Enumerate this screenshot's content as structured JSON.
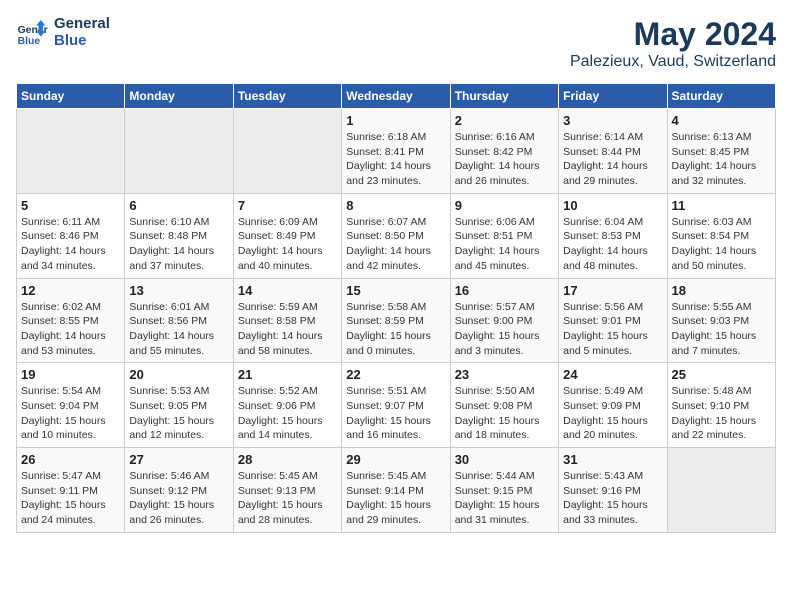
{
  "logo": {
    "line1": "General",
    "line2": "Blue"
  },
  "title": "May 2024",
  "location": "Palezieux, Vaud, Switzerland",
  "days_of_week": [
    "Sunday",
    "Monday",
    "Tuesday",
    "Wednesday",
    "Thursday",
    "Friday",
    "Saturday"
  ],
  "weeks": [
    [
      {
        "day": "",
        "content": ""
      },
      {
        "day": "",
        "content": ""
      },
      {
        "day": "",
        "content": ""
      },
      {
        "day": "1",
        "content": "Sunrise: 6:18 AM\nSunset: 8:41 PM\nDaylight: 14 hours\nand 23 minutes."
      },
      {
        "day": "2",
        "content": "Sunrise: 6:16 AM\nSunset: 8:42 PM\nDaylight: 14 hours\nand 26 minutes."
      },
      {
        "day": "3",
        "content": "Sunrise: 6:14 AM\nSunset: 8:44 PM\nDaylight: 14 hours\nand 29 minutes."
      },
      {
        "day": "4",
        "content": "Sunrise: 6:13 AM\nSunset: 8:45 PM\nDaylight: 14 hours\nand 32 minutes."
      }
    ],
    [
      {
        "day": "5",
        "content": "Sunrise: 6:11 AM\nSunset: 8:46 PM\nDaylight: 14 hours\nand 34 minutes."
      },
      {
        "day": "6",
        "content": "Sunrise: 6:10 AM\nSunset: 8:48 PM\nDaylight: 14 hours\nand 37 minutes."
      },
      {
        "day": "7",
        "content": "Sunrise: 6:09 AM\nSunset: 8:49 PM\nDaylight: 14 hours\nand 40 minutes."
      },
      {
        "day": "8",
        "content": "Sunrise: 6:07 AM\nSunset: 8:50 PM\nDaylight: 14 hours\nand 42 minutes."
      },
      {
        "day": "9",
        "content": "Sunrise: 6:06 AM\nSunset: 8:51 PM\nDaylight: 14 hours\nand 45 minutes."
      },
      {
        "day": "10",
        "content": "Sunrise: 6:04 AM\nSunset: 8:53 PM\nDaylight: 14 hours\nand 48 minutes."
      },
      {
        "day": "11",
        "content": "Sunrise: 6:03 AM\nSunset: 8:54 PM\nDaylight: 14 hours\nand 50 minutes."
      }
    ],
    [
      {
        "day": "12",
        "content": "Sunrise: 6:02 AM\nSunset: 8:55 PM\nDaylight: 14 hours\nand 53 minutes."
      },
      {
        "day": "13",
        "content": "Sunrise: 6:01 AM\nSunset: 8:56 PM\nDaylight: 14 hours\nand 55 minutes."
      },
      {
        "day": "14",
        "content": "Sunrise: 5:59 AM\nSunset: 8:58 PM\nDaylight: 14 hours\nand 58 minutes."
      },
      {
        "day": "15",
        "content": "Sunrise: 5:58 AM\nSunset: 8:59 PM\nDaylight: 15 hours\nand 0 minutes."
      },
      {
        "day": "16",
        "content": "Sunrise: 5:57 AM\nSunset: 9:00 PM\nDaylight: 15 hours\nand 3 minutes."
      },
      {
        "day": "17",
        "content": "Sunrise: 5:56 AM\nSunset: 9:01 PM\nDaylight: 15 hours\nand 5 minutes."
      },
      {
        "day": "18",
        "content": "Sunrise: 5:55 AM\nSunset: 9:03 PM\nDaylight: 15 hours\nand 7 minutes."
      }
    ],
    [
      {
        "day": "19",
        "content": "Sunrise: 5:54 AM\nSunset: 9:04 PM\nDaylight: 15 hours\nand 10 minutes."
      },
      {
        "day": "20",
        "content": "Sunrise: 5:53 AM\nSunset: 9:05 PM\nDaylight: 15 hours\nand 12 minutes."
      },
      {
        "day": "21",
        "content": "Sunrise: 5:52 AM\nSunset: 9:06 PM\nDaylight: 15 hours\nand 14 minutes."
      },
      {
        "day": "22",
        "content": "Sunrise: 5:51 AM\nSunset: 9:07 PM\nDaylight: 15 hours\nand 16 minutes."
      },
      {
        "day": "23",
        "content": "Sunrise: 5:50 AM\nSunset: 9:08 PM\nDaylight: 15 hours\nand 18 minutes."
      },
      {
        "day": "24",
        "content": "Sunrise: 5:49 AM\nSunset: 9:09 PM\nDaylight: 15 hours\nand 20 minutes."
      },
      {
        "day": "25",
        "content": "Sunrise: 5:48 AM\nSunset: 9:10 PM\nDaylight: 15 hours\nand 22 minutes."
      }
    ],
    [
      {
        "day": "26",
        "content": "Sunrise: 5:47 AM\nSunset: 9:11 PM\nDaylight: 15 hours\nand 24 minutes."
      },
      {
        "day": "27",
        "content": "Sunrise: 5:46 AM\nSunset: 9:12 PM\nDaylight: 15 hours\nand 26 minutes."
      },
      {
        "day": "28",
        "content": "Sunrise: 5:45 AM\nSunset: 9:13 PM\nDaylight: 15 hours\nand 28 minutes."
      },
      {
        "day": "29",
        "content": "Sunrise: 5:45 AM\nSunset: 9:14 PM\nDaylight: 15 hours\nand 29 minutes."
      },
      {
        "day": "30",
        "content": "Sunrise: 5:44 AM\nSunset: 9:15 PM\nDaylight: 15 hours\nand 31 minutes."
      },
      {
        "day": "31",
        "content": "Sunrise: 5:43 AM\nSunset: 9:16 PM\nDaylight: 15 hours\nand 33 minutes."
      },
      {
        "day": "",
        "content": ""
      }
    ]
  ]
}
